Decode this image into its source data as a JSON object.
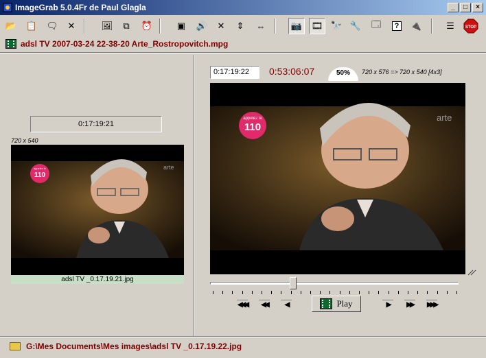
{
  "window": {
    "title": "ImageGrab 5.0.4Fr de Paul Glagla",
    "buttons": {
      "minimize": "_",
      "maximize": "□",
      "close": "×"
    }
  },
  "toolbar": {
    "icons": [
      {
        "name": "open-folder-icon",
        "glyph": "📂"
      },
      {
        "name": "paste-icon",
        "glyph": "📋"
      },
      {
        "name": "comment-icon",
        "glyph": "🗨"
      },
      {
        "name": "close-file-icon",
        "glyph": "✕"
      },
      {
        "name": "picture-icon",
        "glyph": "🖼"
      },
      {
        "name": "copy-icon",
        "glyph": "⧉"
      },
      {
        "name": "alarm-clock-icon",
        "glyph": "⏰"
      },
      {
        "name": "screen-icon",
        "glyph": "▣"
      },
      {
        "name": "speaker-icon",
        "glyph": "🔊"
      },
      {
        "name": "mute-icon",
        "glyph": "✕"
      },
      {
        "name": "vertical-resize-icon",
        "glyph": "⇕"
      },
      {
        "name": "horizontal-resize-icon",
        "glyph": "⇔"
      },
      {
        "name": "camera-icon",
        "glyph": "📷"
      },
      {
        "name": "film-icon",
        "glyph": "🎞"
      },
      {
        "name": "binoculars-icon",
        "glyph": "🔭"
      },
      {
        "name": "tools-icon",
        "glyph": "🔧"
      },
      {
        "name": "settings-window-icon",
        "glyph": "🗔"
      },
      {
        "name": "help-icon",
        "glyph": "?"
      },
      {
        "name": "plugin-icon",
        "glyph": "🔌"
      },
      {
        "name": "list-panel-icon",
        "glyph": "☰"
      },
      {
        "name": "stop-icon",
        "glyph": "STOP"
      }
    ]
  },
  "file": {
    "name": "adsl TV 2007-03-24 22-38-20 Arte_Rostropovitch.mpg"
  },
  "left_panel": {
    "time": "0:17:19:21",
    "resolution": "720 x 540",
    "caption": "adsl TV _0.17.19.21.jpg"
  },
  "right_panel": {
    "current_time": "0:17:19:22",
    "total_time": "0:53:06:07",
    "zoom": "50%",
    "resolution_info": "720 x 576  =>  720 x 540 [4x3]",
    "position_fraction": 0.33,
    "play_label": "Play"
  },
  "overlay": {
    "badge_top": "appelez le",
    "badge_number": "110",
    "channel": "arte"
  },
  "status": {
    "path": "G:\\Mes Documents\\Mes images\\adsl TV _0.17.19.22.jpg"
  },
  "colors": {
    "accent_text": "#800000",
    "title_bar": "#0a246a",
    "caption_bg": "#c7dfc7"
  }
}
